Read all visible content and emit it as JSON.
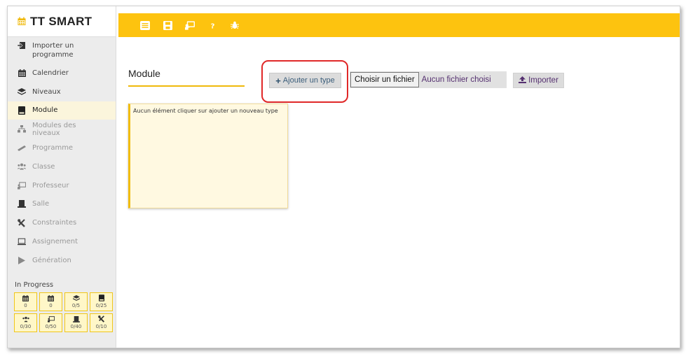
{
  "app": {
    "title": "TT SMART"
  },
  "colors": {
    "accent": "#fdc30f",
    "active_bg": "#fbf5dc",
    "highlight": "#e02828"
  },
  "sidebar": {
    "items": [
      {
        "label": "Importer un programme",
        "icon": "import-icon"
      },
      {
        "label": "Calendrier",
        "icon": "calendar-icon"
      },
      {
        "label": "Niveaux",
        "icon": "layers-icon"
      },
      {
        "label": "Module",
        "icon": "book-icon",
        "active": true
      },
      {
        "label": "Modules des niveaux",
        "icon": "sitemap-icon"
      },
      {
        "label": "Programme",
        "icon": "ruler-icon"
      },
      {
        "label": "Classe",
        "icon": "users-icon"
      },
      {
        "label": "Professeur",
        "icon": "chalkboard-teacher-icon"
      },
      {
        "label": "Salle",
        "icon": "room-icon"
      },
      {
        "label": "Constraintes",
        "icon": "tools-icon"
      },
      {
        "label": "Assignement",
        "icon": "laptop-icon"
      },
      {
        "label": "Génération",
        "icon": "play-icon"
      }
    ],
    "progress_title": "In Progress",
    "stats": [
      {
        "icon": "calendar-icon",
        "value": "0"
      },
      {
        "icon": "calendar-icon",
        "value": "0"
      },
      {
        "icon": "layers-icon",
        "value": "0/5"
      },
      {
        "icon": "book-icon",
        "value": "0/25"
      },
      {
        "icon": "users-icon",
        "value": "0/30"
      },
      {
        "icon": "chalkboard-teacher-icon",
        "value": "0/50"
      },
      {
        "icon": "room-icon",
        "value": "0/40"
      },
      {
        "icon": "tools-icon",
        "value": "0/10"
      }
    ]
  },
  "toolbar": {
    "buttons": [
      {
        "icon": "menu-icon"
      },
      {
        "icon": "save-icon"
      },
      {
        "icon": "chalkboard-teacher-icon"
      },
      {
        "icon": "help-icon"
      },
      {
        "icon": "bug-icon"
      }
    ]
  },
  "main": {
    "title": "Module",
    "add_button": {
      "plus": "+",
      "label": "Ajouter un type"
    },
    "file_input": {
      "button_label": "Choisir un fichier",
      "file_name": "Aucun fichier choisi"
    },
    "import_button": {
      "label": "Importer"
    },
    "empty_card": {
      "text": "Aucun élément cliquer sur ajouter un nouveau type"
    }
  }
}
